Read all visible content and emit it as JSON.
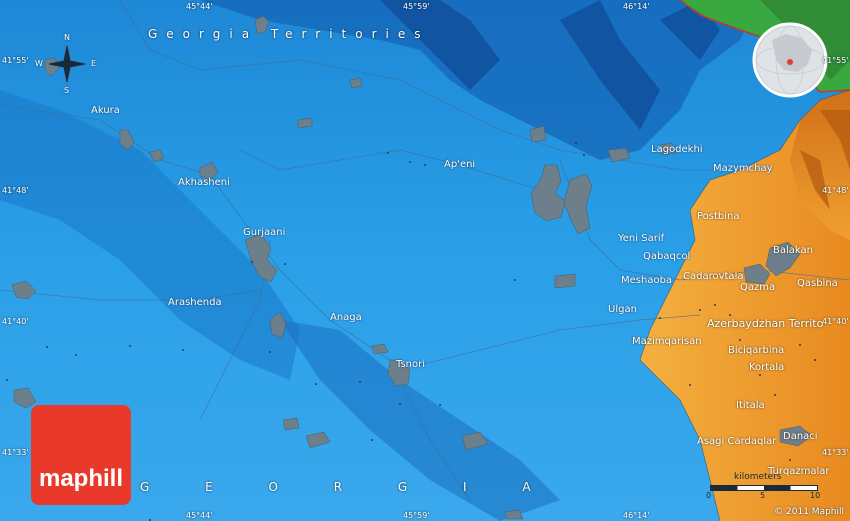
{
  "region_labels": {
    "georgia_territories": "Georgia Territories",
    "georgia": "G E O R G I A",
    "azerbaijan": "Azerbaydzhan Territo"
  },
  "coords": {
    "top": [
      "45°44'",
      "45°59'",
      "46°14'"
    ],
    "bottom": [
      "45°44'",
      "45°59'",
      "46°14'"
    ],
    "left": [
      "41°55'",
      "41°48'",
      "41°40'",
      "41°33'"
    ],
    "right": [
      "41°55'",
      "41°48'",
      "41°40'",
      "41°33'"
    ]
  },
  "places": {
    "akura": "Akura",
    "akhasheni": "Akhasheni",
    "gurjaani": "Gurjaani",
    "arashenda": "Arashenda",
    "anaga": "Anaga",
    "tsnori": "Tsnori",
    "apeni": "Ap'eni",
    "lagodekhi": "Lagodekhi",
    "mazymchay": "Mazymchay",
    "postbina": "Postbina",
    "yeni_sarif": "Yeni Sarif",
    "qabaqcol": "Qabaqcol",
    "balakan": "Balakan",
    "cadarovtala": "Cadarovtala",
    "meshaoba": "Meshaoba",
    "qazma": "Qazma",
    "qasbina": "Qasbina",
    "ulgan": "Ulgan",
    "mazimqarisan": "Mazimqarisan",
    "biciqarbina": "Biciqarbina",
    "kortala": "Kortala",
    "ititala": "Ititala",
    "asagi_cardaqlar": "Asagi Cardaqlar",
    "danaci": "Danaci",
    "turqazmalar": "Turqazmalar"
  },
  "compass": {
    "n": "N",
    "s": "S",
    "e": "E",
    "w": "W"
  },
  "scale": {
    "title": "kilometers",
    "ticks": [
      "0",
      "5",
      "10"
    ]
  },
  "logo_text": "maphill",
  "copyright": "© 2011 Maphill",
  "colors": {
    "water": "#2b9be0",
    "lowland": "#f0a830",
    "highland": "#e07020",
    "forest": "#3aa840",
    "logo": "#e8392b"
  }
}
